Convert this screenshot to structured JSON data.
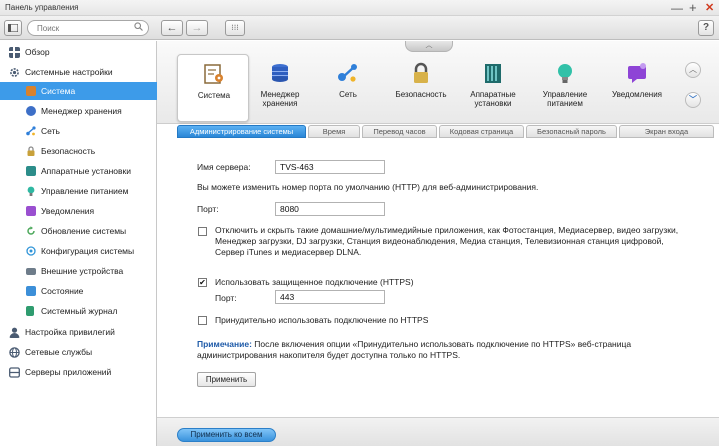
{
  "window": {
    "title": "Панель управления",
    "minimize": "—",
    "maximize": "+",
    "close": "✕"
  },
  "toolbar": {
    "search_placeholder": "Поиск",
    "search_icon": "search-icon",
    "back": "←",
    "forward": "→",
    "apps": "⁝⁝⁝",
    "help": "?"
  },
  "sidebar": {
    "overview": "Обзор",
    "system_settings": "Системные настройки",
    "items": [
      {
        "label": "Система",
        "color": "#d8822e"
      },
      {
        "label": "Менеджер хранения",
        "color": "#3d6fc7"
      },
      {
        "label": "Сеть",
        "color": "#2f7fd9"
      },
      {
        "label": "Безопасность",
        "color": "#8b8b8b"
      },
      {
        "label": "Аппаратные установки",
        "color": "#2c8d8a"
      },
      {
        "label": "Управление питанием",
        "color": "#2fb8a2"
      },
      {
        "label": "Уведомления",
        "color": "#9a4fd0"
      },
      {
        "label": "Обновление системы",
        "color": "#4ca85b"
      },
      {
        "label": "Конфигурация системы",
        "color": "#2f94d8"
      },
      {
        "label": "Внешние устройства",
        "color": "#6e7c8a"
      },
      {
        "label": "Состояние",
        "color": "#3c8fd8"
      },
      {
        "label": "Системный журнал",
        "color": "#2f9c6f"
      }
    ],
    "privileges": "Настройка привилегий",
    "network_services": "Сетевые службы",
    "app_servers": "Серверы приложений"
  },
  "ribbon": {
    "collapse": "︿",
    "categories": [
      {
        "label": "Система",
        "icon": "system-icon",
        "color": "#b07a3a"
      },
      {
        "label": "Менеджер хранения",
        "icon": "storage-icon",
        "color": "#2f5fc0"
      },
      {
        "label": "Сеть",
        "icon": "network-icon",
        "color": "#2f7fd9"
      },
      {
        "label": "Безопасность",
        "icon": "lock-icon",
        "color": "#5a5a5a"
      },
      {
        "label": "Аппаратные установки",
        "icon": "hardware-icon",
        "color": "#1f7a7a"
      },
      {
        "label": "Управление питанием",
        "icon": "power-icon",
        "color": "#31c1a8"
      },
      {
        "label": "Уведомления",
        "icon": "notification-icon",
        "color": "#8e44d6"
      }
    ],
    "scroll_up": "︿",
    "scroll_down": "﹀"
  },
  "tabs": [
    "Администрирование системы",
    "Время",
    "Перевод часов",
    "Кодовая страница",
    "Безопасный пароль",
    "Экран входа"
  ],
  "form": {
    "server_name_label": "Имя сервера:",
    "server_name": "TVS-463",
    "port_hint": "Вы можете изменить номер порта по умолчанию (HTTP) для веб-администрирования.",
    "port_label": "Порт:",
    "port": "8080",
    "hide_apps_checked": false,
    "hide_apps_text": "Отключить и скрыть такие домашние/мультимедийные приложения, как Фотостанция, Медиасервер, видео загрузки, Менеджер загрузки, DJ загрузки, Станция видеонаблюдения, Медиа станция, Телевизионная станция цифровой, Сервер iTunes и медиасервер DLNA.",
    "https_checked": true,
    "https_check_mark": "✔",
    "https_text": "Использовать защищенное подключение (HTTPS)",
    "https_port_label": "Порт:",
    "https_port": "443",
    "force_https_checked": false,
    "force_https_text": "Принудительно использовать подключение по HTTPS",
    "note_label": "Примечание:",
    "note_text": " После включения опции «Принудительно использовать подключение по HTTPS» веб-страница администрирования накопителя будет доступна только по HTTPS.",
    "apply": "Применить"
  },
  "footer": {
    "apply_all": "Применить ко всем"
  },
  "colors": {
    "accent": "#3d9be9",
    "note": "#1e5aa8"
  }
}
